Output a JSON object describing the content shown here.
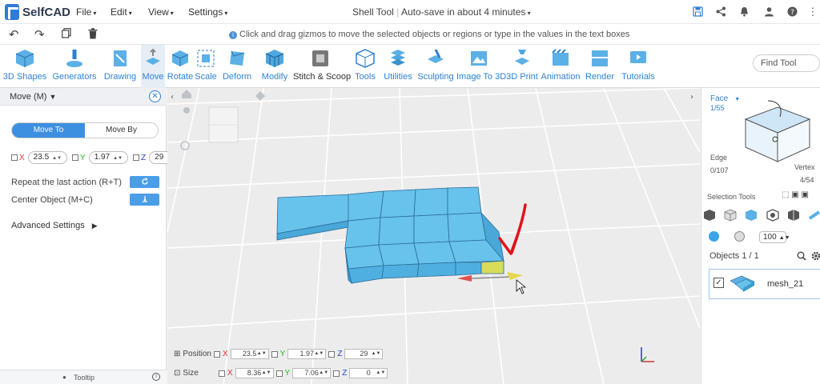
{
  "app": {
    "name": "SelfCAD",
    "title": "Shell Tool",
    "autosave": "Auto-save in about 4 minutes"
  },
  "menu": [
    "File",
    "Edit",
    "View",
    "Settings"
  ],
  "hint": "Click and drag gizmos to move the selected objects or regions or type in the values in the text boxes",
  "toolbar": {
    "tools": [
      "3D Shapes",
      "Generators",
      "Drawing",
      "Move",
      "Rotate",
      "Scale",
      "Deform",
      "Modify",
      "Stitch & Scoop",
      "Tools",
      "Utilities",
      "Sculpting",
      "Image To 3D",
      "3D Print",
      "Animation",
      "Render",
      "Tutorials"
    ],
    "find_tool": "Find Tool"
  },
  "left_panel": {
    "title": "Move (M)",
    "move_to": "Move To",
    "move_by": "Move By",
    "x": "23.5",
    "y": "1.97",
    "z": "29",
    "x_label": "X",
    "y_label": "Y",
    "z_label": "Z",
    "repeat": "Repeat the last action (R+T)",
    "center": "Center Object (M+C)",
    "advanced": "Advanced Settings",
    "tooltip": "Tooltip"
  },
  "right_panel": {
    "face": "Face",
    "face_count": "1/55",
    "edge": "Edge",
    "edge_count": "0/107",
    "vertex": "Vertex",
    "vertex_count": "4/54",
    "selection_tools": "Selection Tools",
    "brush_size": "100",
    "objects": "Objects 1 / 1",
    "object_name": "mesh_21"
  },
  "bottom": {
    "position_label": "Position",
    "size_label": "Size",
    "position": {
      "x": "23.5",
      "y": "1.97",
      "z": "29"
    },
    "size": {
      "x": "8.36",
      "y": "7.06",
      "z": "0"
    }
  },
  "colors": {
    "accent": "#2f82d4",
    "mesh": "#5bbbe8",
    "mesh_selected": "#d7dc5a",
    "viewport": "#ececed",
    "annotation": "#e0131b"
  }
}
